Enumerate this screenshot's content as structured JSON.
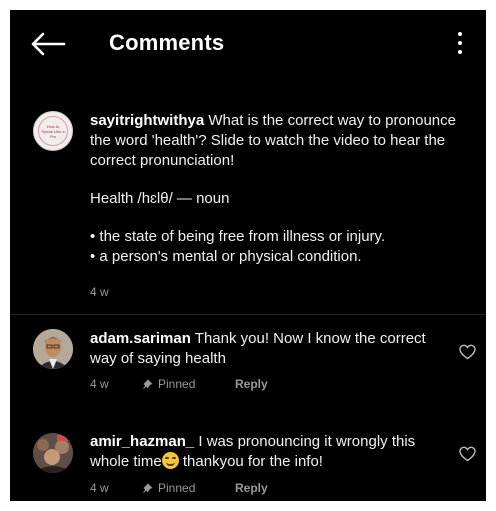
{
  "header": {
    "title": "Comments"
  },
  "caption": {
    "avatar_text": "How to Speak Like a Pro",
    "username": "sayitrightwithya",
    "text": " What is the correct way to pronounce the word 'health'? Slide to watch the video to hear the correct pronunciation!",
    "pronunciation": "Health /hɛlθ/ — noun",
    "definition_1": "• the state of being free from illness or injury.",
    "definition_2": "• a person's mental or physical condition.",
    "time": "4 w"
  },
  "comments": [
    {
      "username": "adam.sariman",
      "text": " Thank you! Now I know the correct way of saying health",
      "time": "4 w",
      "pinned": "Pinned",
      "reply": "Reply"
    },
    {
      "username": "amir_hazman_",
      "text_a": " I was pronouncing it wrongly this whole time",
      "emoji": "smiling-face-emoji",
      "text_b": " thankyou for the info!",
      "time": "4 w",
      "pinned": "Pinned",
      "reply": "Reply"
    }
  ],
  "icons": {
    "back": "arrow-left-icon",
    "more": "more-vertical-icon",
    "heart": "heart-outline-icon",
    "pin": "pin-icon"
  },
  "colors": {
    "background": "#000000",
    "text": "#f1f1f1",
    "muted": "#9a9a9a",
    "divider": "#262626"
  }
}
